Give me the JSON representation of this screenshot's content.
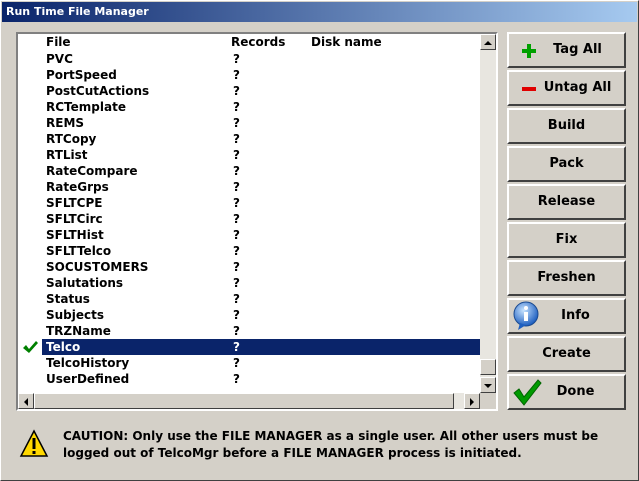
{
  "window": {
    "title": "Run Time File Manager"
  },
  "list": {
    "headers": {
      "file": "File",
      "records": "Records",
      "disk": "Disk name"
    },
    "rows": [
      {
        "file": "PVC",
        "records": "?"
      },
      {
        "file": "PortSpeed",
        "records": "?"
      },
      {
        "file": "PostCutActions",
        "records": "?"
      },
      {
        "file": "RCTemplate",
        "records": "?"
      },
      {
        "file": "REMS",
        "records": "?"
      },
      {
        "file": "RTCopy",
        "records": "?"
      },
      {
        "file": "RTList",
        "records": "?"
      },
      {
        "file": "RateCompare",
        "records": "?"
      },
      {
        "file": "RateGrps",
        "records": "?"
      },
      {
        "file": "SFLTCPE",
        "records": "?"
      },
      {
        "file": "SFLTCirc",
        "records": "?"
      },
      {
        "file": "SFLTHist",
        "records": "?"
      },
      {
        "file": "SFLTTelco",
        "records": "?"
      },
      {
        "file": "SOCUSTOMERS",
        "records": "?"
      },
      {
        "file": "Salutations",
        "records": "?"
      },
      {
        "file": "Status",
        "records": "?"
      },
      {
        "file": "Subjects",
        "records": "?"
      },
      {
        "file": "TRZName",
        "records": "?"
      },
      {
        "file": "Telco",
        "records": "?",
        "selected": true,
        "tagged": true
      },
      {
        "file": "TelcoHistory",
        "records": "?"
      },
      {
        "file": "UserDefined",
        "records": "?"
      }
    ]
  },
  "buttons": {
    "tag_all": "Tag All",
    "untag_all": "Untag All",
    "build": "Build",
    "pack": "Pack",
    "release": "Release",
    "fix": "Fix",
    "freshen": "Freshen",
    "info": "Info",
    "create": "Create",
    "done": "Done"
  },
  "caution": {
    "line1": "CAUTION: Only use the FILE MANAGER as a single user. All other users must be",
    "line2": "logged out of TelcoMgr before a FILE MANAGER process is initiated."
  },
  "icons": {
    "tag": "plus-icon",
    "untag": "minus-icon",
    "info": "info-icon",
    "done": "checkmark-icon",
    "caution": "warning-icon",
    "row_tag": "checkmark-icon"
  },
  "colors": {
    "selection": "#0a246a",
    "plus": "#00a000",
    "minus": "#e00000",
    "check": "#008000"
  }
}
